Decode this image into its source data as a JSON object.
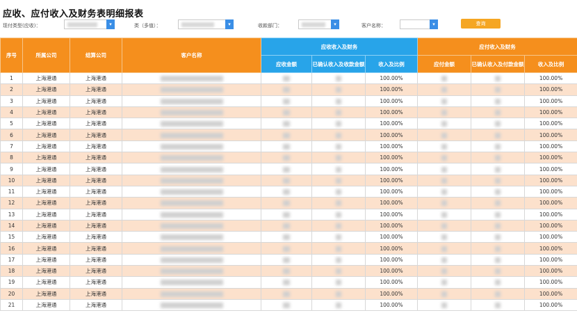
{
  "title": "应收、应付收入及财务表明细报表",
  "filters": {
    "receivable_label": "现付类型(应收)：",
    "type_label": "类（多值）：",
    "department_label": "收款部门：",
    "customer_label": "客户名称：",
    "query_button": "查询"
  },
  "colors": {
    "header_orange": "#f58f1d",
    "header_blue": "#28a4e9",
    "row_stripe": "#fce1cc",
    "button": "#f5a623",
    "dropdown": "#3a8ee6"
  },
  "table": {
    "headers": {
      "seq": "序号",
      "company": "所属公司",
      "settle_company": "结算公司",
      "customer": "客户名称",
      "group_receivable": "应收收入及财务",
      "group_payable": "应付收入及财务",
      "rec_amount": "应收金额",
      "rec_confirmed": "已确认收入及收款金额",
      "rec_ratio": "收入及比例",
      "pay_amount": "应付金额",
      "pay_confirmed": "已确认收入及付款金额",
      "pay_ratio": "收入及比例"
    },
    "rows": [
      {
        "seq": "1",
        "company": "上海港通",
        "settle": "上海港通",
        "rec_ratio": "100.00%",
        "pay_ratio": "100.00%"
      },
      {
        "seq": "2",
        "company": "上海港通",
        "settle": "上海港通",
        "rec_ratio": "100.00%",
        "pay_ratio": "100.00%"
      },
      {
        "seq": "3",
        "company": "上海港通",
        "settle": "上海港通",
        "rec_ratio": "100.00%",
        "pay_ratio": "100.00%"
      },
      {
        "seq": "4",
        "company": "上海港通",
        "settle": "上海港通",
        "rec_ratio": "100.00%",
        "pay_ratio": "100.00%"
      },
      {
        "seq": "5",
        "company": "上海港通",
        "settle": "上海港通",
        "rec_ratio": "100.00%",
        "pay_ratio": "100.00%"
      },
      {
        "seq": "6",
        "company": "上海港通",
        "settle": "上海港通",
        "rec_ratio": "100.00%",
        "pay_ratio": "100.00%"
      },
      {
        "seq": "7",
        "company": "上海港通",
        "settle": "上海港通",
        "rec_ratio": "100.00%",
        "pay_ratio": "100.00%"
      },
      {
        "seq": "8",
        "company": "上海港通",
        "settle": "上海港通",
        "rec_ratio": "100.00%",
        "pay_ratio": "100.00%"
      },
      {
        "seq": "9",
        "company": "上海港通",
        "settle": "上海港通",
        "rec_ratio": "100.00%",
        "pay_ratio": "100.00%"
      },
      {
        "seq": "10",
        "company": "上海港通",
        "settle": "上海港通",
        "rec_ratio": "100.00%",
        "pay_ratio": "100.00%"
      },
      {
        "seq": "11",
        "company": "上海港通",
        "settle": "上海港通",
        "rec_ratio": "100.00%",
        "pay_ratio": "100.00%"
      },
      {
        "seq": "12",
        "company": "上海港通",
        "settle": "上海港通",
        "rec_ratio": "100.00%",
        "pay_ratio": "100.00%"
      },
      {
        "seq": "13",
        "company": "上海港通",
        "settle": "上海港通",
        "rec_ratio": "100.00%",
        "pay_ratio": "100.00%"
      },
      {
        "seq": "14",
        "company": "上海港通",
        "settle": "上海港通",
        "rec_ratio": "100.00%",
        "pay_ratio": "100.00%"
      },
      {
        "seq": "15",
        "company": "上海港通",
        "settle": "上海港通",
        "rec_ratio": "100.00%",
        "pay_ratio": "100.00%"
      },
      {
        "seq": "16",
        "company": "上海港通",
        "settle": "上海港通",
        "rec_ratio": "100.00%",
        "pay_ratio": "100.00%"
      },
      {
        "seq": "17",
        "company": "上海港通",
        "settle": "上海港通",
        "rec_ratio": "100.00%",
        "pay_ratio": "100.00%"
      },
      {
        "seq": "18",
        "company": "上海港通",
        "settle": "上海港通",
        "rec_ratio": "100.00%",
        "pay_ratio": "100.00%"
      },
      {
        "seq": "19",
        "company": "上海港通",
        "settle": "上海港通",
        "rec_ratio": "100.00%",
        "pay_ratio": "100.00%"
      },
      {
        "seq": "20",
        "company": "上海港通",
        "settle": "上海港通",
        "rec_ratio": "100.00%",
        "pay_ratio": "100.00%"
      },
      {
        "seq": "21",
        "company": "上海港通",
        "settle": "上海港通",
        "rec_ratio": "100.00%",
        "pay_ratio": "100.00%"
      }
    ]
  }
}
